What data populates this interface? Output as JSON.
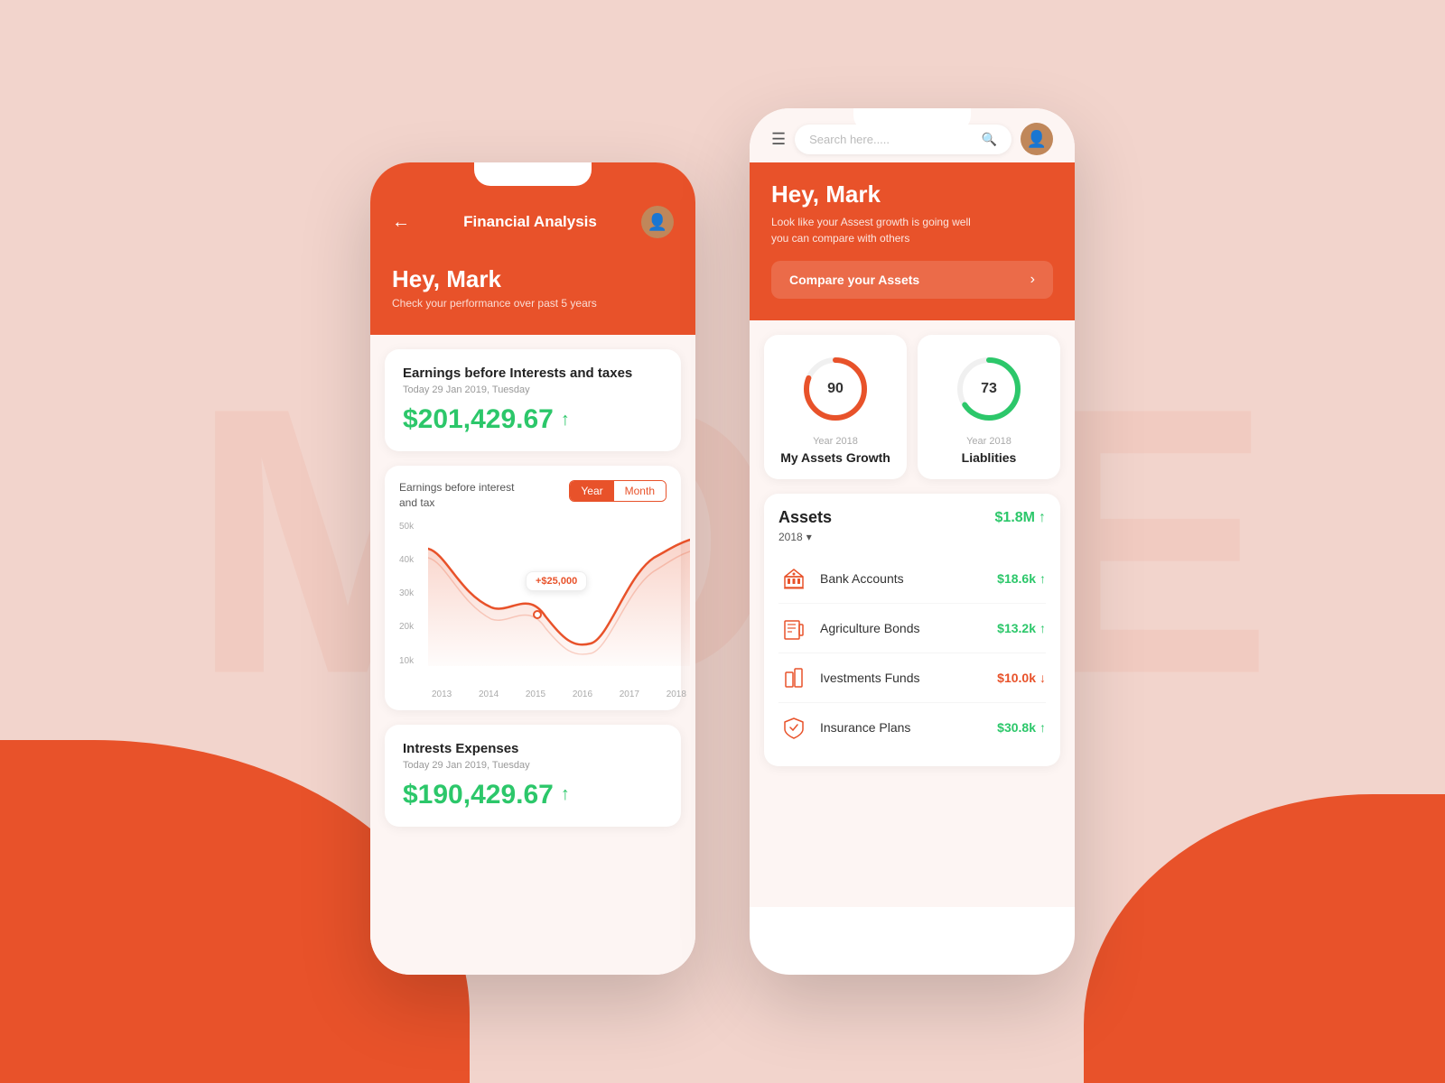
{
  "background": {
    "text": "MORE"
  },
  "leftPhone": {
    "title": "Financial Analysis",
    "greeting": "Hey, Mark",
    "greetingSub": "Check your performance over past 5 years",
    "earningsCard": {
      "title": "Earnings before Interests and taxes",
      "date": "Today 29 Jan 2019, Tuesday",
      "amount": "$201,429.67",
      "trend": "up"
    },
    "chartLabel": "Earnings before interest and tax",
    "tabs": [
      "Year",
      "Month"
    ],
    "activeTab": "Year",
    "tooltip": "+$25,000",
    "chartYears": [
      "2013",
      "2014",
      "2015",
      "2016",
      "2017",
      "2018"
    ],
    "chartYLabels": [
      "50k",
      "40k",
      "30k",
      "20k",
      "10k"
    ],
    "interestCard": {
      "title": "Intrests Expenses",
      "date": "Today 29 Jan 2019, Tuesday",
      "amount": "$190,429.67",
      "trend": "up"
    }
  },
  "rightPhone": {
    "search": {
      "placeholder": "Search here....."
    },
    "greeting": "Hey, Mark",
    "heroSub1": "Look like your Assest growth is going well",
    "heroSub2": "you can compare with others",
    "compareBtn": "Compare your Assets",
    "card1": {
      "value": 90,
      "year": "Year 2018",
      "title": "My Assets Growth",
      "color": "#e8522a"
    },
    "card2": {
      "value": 73,
      "year": "Year 2018",
      "title": "Liablities",
      "color": "#2cc76a"
    },
    "assetsTitle": "Assets",
    "assetsTotal": "$1.8M",
    "assetsYear": "2018",
    "assetsList": [
      {
        "name": "Bank Accounts",
        "amount": "$18.6k",
        "trend": "up"
      },
      {
        "name": "Agriculture Bonds",
        "amount": "$13.2k",
        "trend": "up"
      },
      {
        "name": "Ivestments Funds",
        "amount": "$10.0k",
        "trend": "down"
      },
      {
        "name": "Insurance Plans",
        "amount": "$30.8k",
        "trend": "up"
      }
    ]
  }
}
